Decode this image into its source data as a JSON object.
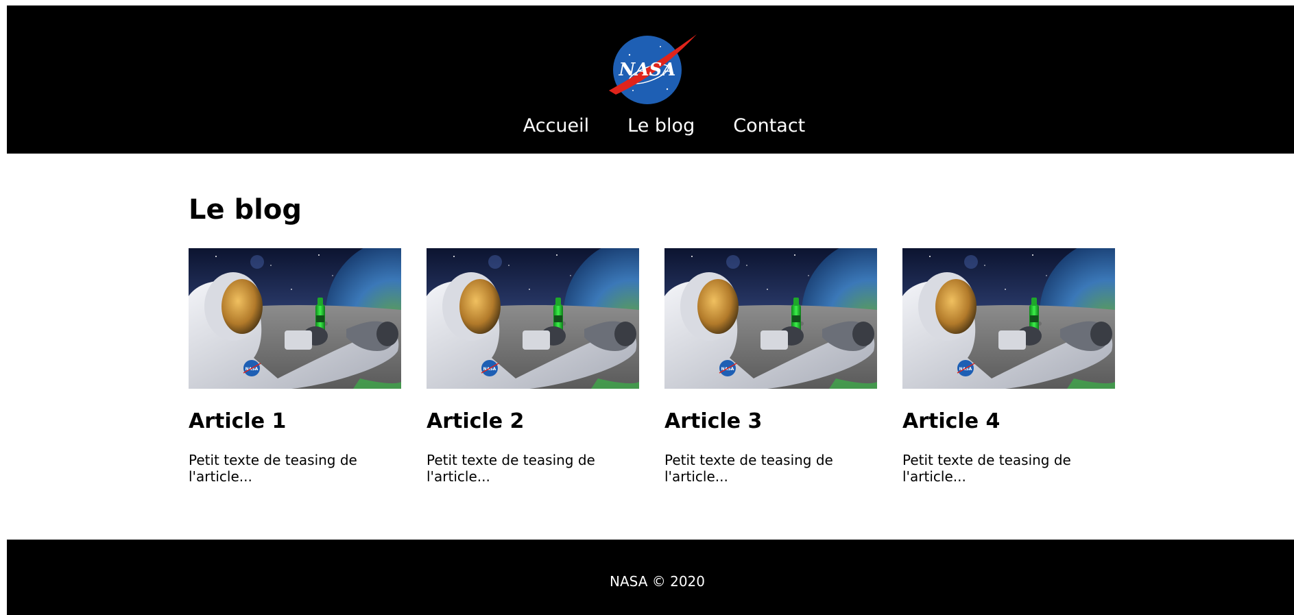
{
  "header": {
    "logo_text": "NASA",
    "nav": [
      {
        "label": "Accueil"
      },
      {
        "label": "Le blog"
      },
      {
        "label": "Contact"
      }
    ]
  },
  "main": {
    "title": "Le blog",
    "articles": [
      {
        "title": "Article 1",
        "teaser": "Petit texte de teasing de l'article..."
      },
      {
        "title": "Article 2",
        "teaser": "Petit texte de teasing de l'article..."
      },
      {
        "title": "Article 3",
        "teaser": "Petit texte de teasing de l'article..."
      },
      {
        "title": "Article 4",
        "teaser": "Petit texte de teasing de l'article..."
      }
    ]
  },
  "footer": {
    "copyright": "NASA © 2020"
  },
  "colors": {
    "header_bg": "#000000",
    "footer_bg": "#000000",
    "nav_text": "#ffffff",
    "logo_blue": "#1e5fb4",
    "logo_red": "#e0241b"
  }
}
